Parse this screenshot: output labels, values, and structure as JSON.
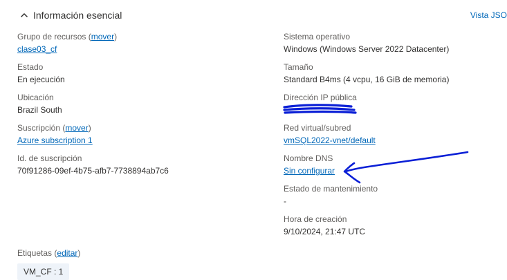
{
  "section": {
    "title": "Información esencial",
    "json_view_label": "Vista JSO"
  },
  "left": [
    {
      "label": "Grupo de recursos",
      "action": "mover",
      "value": "clase03_cf",
      "value_is_link": true
    },
    {
      "label": "Estado",
      "value": "En ejecución",
      "value_is_link": false
    },
    {
      "label": "Ubicación",
      "value": "Brazil South",
      "value_is_link": false
    },
    {
      "label": "Suscripción",
      "action": "mover",
      "value": "Azure subscription 1",
      "value_is_link": true
    },
    {
      "label": "Id. de suscripción",
      "value": "70f91286-09ef-4b75-afb7-7738894ab7c6",
      "value_is_link": false
    }
  ],
  "right": [
    {
      "label": "Sistema operativo",
      "value": "Windows (Windows Server 2022 Datacenter)",
      "value_is_link": false
    },
    {
      "label": "Tamaño",
      "value": "Standard B4ms (4 vcpu, 16 GiB de memoria)",
      "value_is_link": false
    },
    {
      "label": "Dirección IP pública",
      "value": "",
      "value_is_link": false,
      "redacted": true
    },
    {
      "label": "Red virtual/subred",
      "value": "vmSQL2022-vnet/default",
      "value_is_link": true
    },
    {
      "label": "Nombre DNS",
      "value": "Sin configurar",
      "value_is_link": true
    },
    {
      "label": "Estado de mantenimiento",
      "value": "-",
      "value_is_link": false
    },
    {
      "label": "Hora de creación",
      "value": "9/10/2024, 21:47 UTC",
      "value_is_link": false
    }
  ],
  "tags": {
    "label": "Etiquetas",
    "action": "editar",
    "items": [
      "VM_CF : 1"
    ]
  },
  "colors": {
    "link": "#0067b8",
    "label": "#605e5c",
    "text": "#323130",
    "annotation": "#0a1fd6",
    "tag_bg": "#eef3f9"
  },
  "icons": {
    "collapse": "chevron-up-icon"
  }
}
